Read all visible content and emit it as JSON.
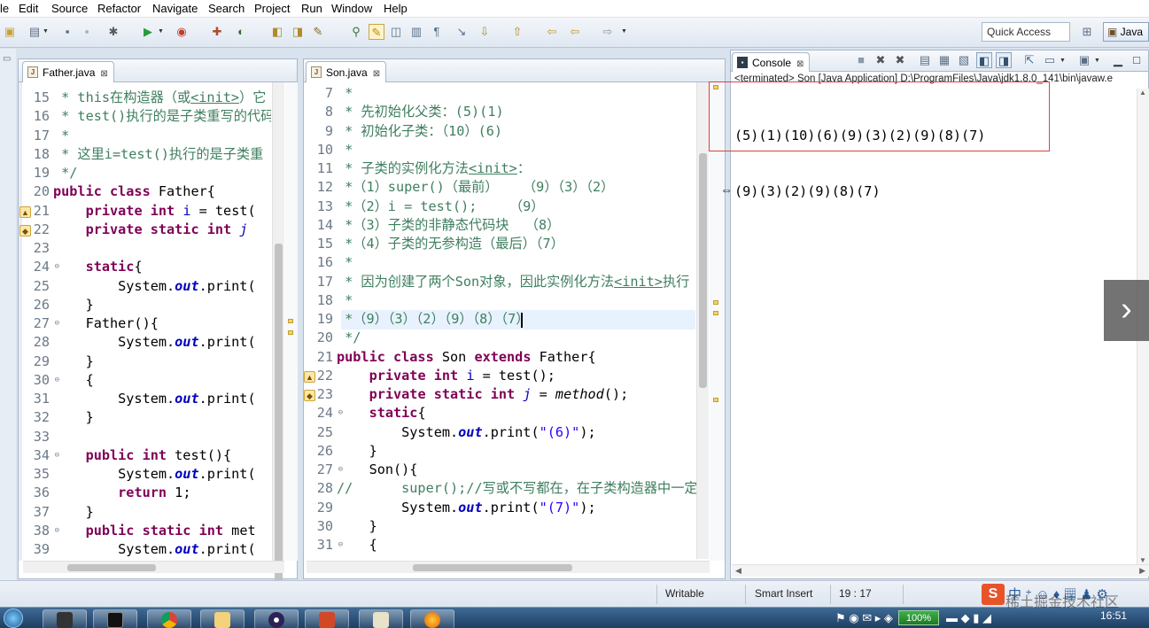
{
  "menu": [
    "le",
    "Edit",
    "Source",
    "Refactor",
    "Navigate",
    "Search",
    "Project",
    "Run",
    "Window",
    "Help"
  ],
  "toolbar": {
    "quick_access_placeholder": "Quick Access",
    "perspective": "Java"
  },
  "father_tab": {
    "label": "Father.java",
    "close": "⊠"
  },
  "son_tab": {
    "label": "Son.java",
    "close": "⊠"
  },
  "console_tab": {
    "label": "Console",
    "close": "⊠"
  },
  "father_code": [
    {
      "n": "15",
      "html": "<span class=\"cm\"> * this在构造器（或<u>&lt;init&gt;</u>）它</span>"
    },
    {
      "n": "16",
      "html": "<span class=\"cm\"> * test()执行的是子类重写的代码</span>"
    },
    {
      "n": "17",
      "html": "<span class=\"cm\"> *</span>"
    },
    {
      "n": "18",
      "html": "<span class=\"cm\"> * 这里i=test()执行的是子类重</span>"
    },
    {
      "n": "19",
      "html": "<span class=\"cm\"> */</span>"
    },
    {
      "n": "20",
      "html": "<span class=\"kw\">public class</span> Father{"
    },
    {
      "n": "21",
      "html": "    <span class=\"kw\">private int</span> <span class=\"fi\">i</span> = test("
    },
    {
      "n": "22",
      "html": "    <span class=\"kw\">private static int</span> <span class=\"fi it\">j</span>"
    },
    {
      "n": "23",
      "html": ""
    },
    {
      "n": "24",
      "html": "    <span class=\"kw\">static</span>{"
    },
    {
      "n": "25",
      "html": "        System.<span class=\"fld\">out</span>.print("
    },
    {
      "n": "26",
      "html": "    }"
    },
    {
      "n": "27",
      "html": "    Father(){"
    },
    {
      "n": "28",
      "html": "        System.<span class=\"fld\">out</span>.print("
    },
    {
      "n": "29",
      "html": "    }"
    },
    {
      "n": "30",
      "html": "    {"
    },
    {
      "n": "31",
      "html": "        System.<span class=\"fld\">out</span>.print("
    },
    {
      "n": "32",
      "html": "    }"
    },
    {
      "n": "33",
      "html": ""
    },
    {
      "n": "34",
      "html": "    <span class=\"kw\">public int</span> test(){"
    },
    {
      "n": "35",
      "html": "        System.<span class=\"fld\">out</span>.print("
    },
    {
      "n": "36",
      "html": "        <span class=\"kw\">return</span> 1;"
    },
    {
      "n": "37",
      "html": "    }"
    },
    {
      "n": "38",
      "html": "    <span class=\"kw\">public static int</span> met"
    },
    {
      "n": "39",
      "html": "        System.<span class=\"fld\">out</span>.print("
    }
  ],
  "son_code": [
    {
      "n": "7",
      "html": "<span class=\"cm\"> *</span>"
    },
    {
      "n": "8",
      "html": "<span class=\"cm\"> * 先初始化父类：(5)(1)</span>"
    },
    {
      "n": "9",
      "html": "<span class=\"cm\"> * 初始化子类：（10）(6)</span>"
    },
    {
      "n": "10",
      "html": "<span class=\"cm\"> *</span>"
    },
    {
      "n": "11",
      "html": "<span class=\"cm\"> * 子类的实例化方法<u>&lt;init&gt;</u>：</span>"
    },
    {
      "n": "12",
      "html": "<span class=\"cm\"> *（1）super()（最前）   （9）（3）（2）</span>"
    },
    {
      "n": "13",
      "html": "<span class=\"cm\"> *（2）i = test();    （9）</span>"
    },
    {
      "n": "14",
      "html": "<span class=\"cm\"> *（3）子类的非静态代码块  （8）</span>"
    },
    {
      "n": "15",
      "html": "<span class=\"cm\"> *（4）子类的无参构造（最后）（7）</span>"
    },
    {
      "n": "16",
      "html": "<span class=\"cm\"> *</span>"
    },
    {
      "n": "17",
      "html": "<span class=\"cm\"> * 因为创建了两个Son对象，因此实例化方法<u>&lt;init&gt;</u>执行</span>"
    },
    {
      "n": "18",
      "html": "<span class=\"cm\"> *</span>"
    },
    {
      "n": "19",
      "html": "<span class=\"cm\"> *（9）（3）（2）（9）（8）（7）</span>"
    },
    {
      "n": "20",
      "html": "<span class=\"cm\"> */</span>"
    },
    {
      "n": "21",
      "html": "<span class=\"kw\">public class</span> Son <span class=\"kw\">extends</span> Father{"
    },
    {
      "n": "22",
      "html": "    <span class=\"kw\">private int</span> <span class=\"fi\">i</span> = test();"
    },
    {
      "n": "23",
      "html": "    <span class=\"kw\">private static int</span> <span class=\"fi it\">j</span> = <span class=\"it\">method</span>();"
    },
    {
      "n": "24",
      "html": "    <span class=\"kw\">static</span>{"
    },
    {
      "n": "25",
      "html": "        System.<span class=\"fld\">out</span>.print(<span class=\"str\">\"(6)\"</span>);"
    },
    {
      "n": "26",
      "html": "    }"
    },
    {
      "n": "27",
      "html": "    Son(){"
    },
    {
      "n": "28",
      "html": "<span class=\"cm\">//      super();//写或不写都在，在子类构造器中一定</span>"
    },
    {
      "n": "29",
      "html": "        System.<span class=\"fld\">out</span>.print(<span class=\"str\">\"(7)\"</span>);"
    },
    {
      "n": "30",
      "html": "    }"
    },
    {
      "n": "31",
      "html": "    {"
    }
  ],
  "console": {
    "terminated": "<terminated> Son [Java Application] D:\\ProgramFiles\\Java\\jdk1.8.0_141\\bin\\javaw.e",
    "lines": [
      "(5)(1)(10)(6)(9)(3)(2)(9)(8)(7)",
      "(9)(3)(2)(9)(8)(7)"
    ]
  },
  "status": {
    "writable": "Writable",
    "insert": "Smart Insert",
    "position": "19 : 17"
  },
  "taskbar": {
    "time": "16:51",
    "battery": "100%",
    "watermark": "稀土掘金技术社区"
  }
}
